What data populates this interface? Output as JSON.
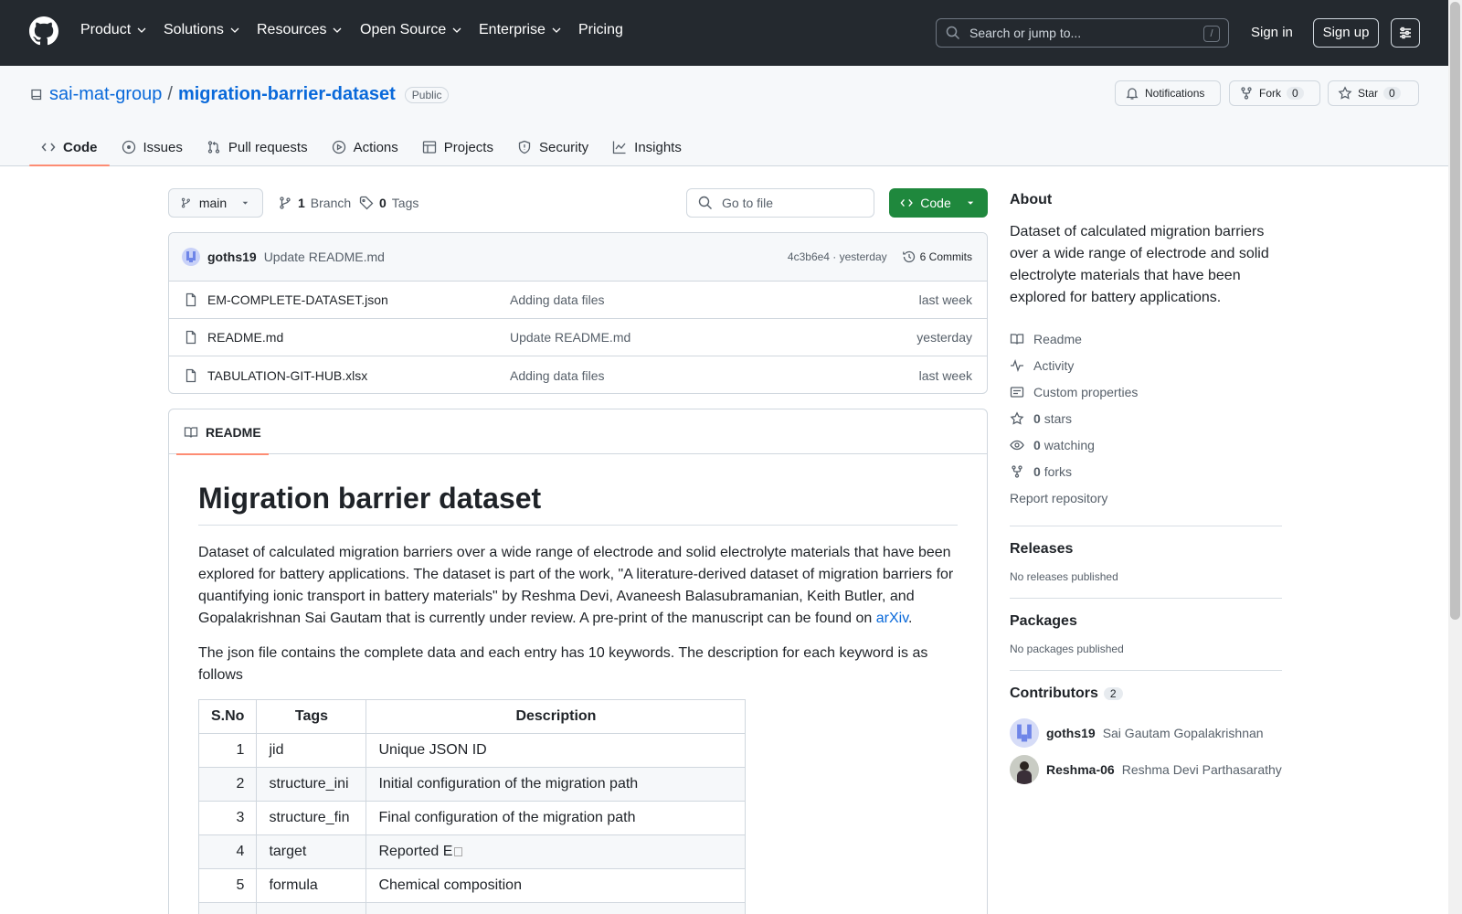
{
  "header": {
    "nav": [
      "Product",
      "Solutions",
      "Resources",
      "Open Source",
      "Enterprise",
      "Pricing"
    ],
    "search_placeholder": "Search or jump to...",
    "slash": "/",
    "sign_in": "Sign in",
    "sign_up": "Sign up"
  },
  "repo": {
    "owner": "sai-mat-group",
    "sep": "/",
    "name": "migration-barrier-dataset",
    "visibility": "Public",
    "notifications": "Notifications",
    "fork_label": "Fork",
    "fork_count": "0",
    "star_label": "Star",
    "star_count": "0"
  },
  "tabs": [
    "Code",
    "Issues",
    "Pull requests",
    "Actions",
    "Projects",
    "Security",
    "Insights"
  ],
  "toolbar": {
    "branch": "main",
    "branch_count": "1",
    "branch_label": "Branch",
    "tag_count": "0",
    "tag_label": "Tags",
    "goto_placeholder": "Go to file",
    "code_label": "Code"
  },
  "commit": {
    "user": "goths19",
    "message": "Update README.md",
    "hash": "4c3b6e4 · yesterday",
    "commits": "6 Commits"
  },
  "files": [
    {
      "name": "EM-COMPLETE-DATASET.json",
      "message": "Adding data files",
      "age": "last week"
    },
    {
      "name": "README.md",
      "message": "Update README.md",
      "age": "yesterday"
    },
    {
      "name": "TABULATION-GIT-HUB.xlsx",
      "message": "Adding data files",
      "age": "last week"
    }
  ],
  "readme": {
    "tab": "README",
    "title": "Migration barrier dataset",
    "p1_a": "Dataset of calculated migration barriers over a wide range of electrode and solid electrolyte materials that have been explored for battery applications. The dataset is part of the work, \"A literature-derived dataset of migration barriers for quantifying ionic transport in battery materials\" by Reshma Devi, Avaneesh Balasubramanian, Keith Butler, and Gopalakrishnan Sai Gautam that is currently under review. A pre-print of the manuscript can be found on ",
    "p1_link": "arXiv",
    "p1_end": ".",
    "p2": "The json file contains the complete data and each entry has 10 keywords. The description for each keyword is as follows",
    "table_headers": [
      "S.No",
      "Tags",
      "Description"
    ],
    "rows": [
      {
        "n": "1",
        "tag": "jid",
        "desc": "Unique JSON ID"
      },
      {
        "n": "2",
        "tag": "structure_ini",
        "desc": "Initial configuration of the migration path"
      },
      {
        "n": "3",
        "tag": "structure_fin",
        "desc": "Final configuration of the migration path"
      },
      {
        "n": "4",
        "tag": "target",
        "desc": "Reported E"
      },
      {
        "n": "5",
        "tag": "formula",
        "desc": "Chemical composition"
      },
      {
        "n": "",
        "tag": "",
        "desc": ""
      }
    ]
  },
  "about": {
    "heading": "About",
    "description": "Dataset of calculated migration barriers over a wide range of electrode and solid electrolyte materials that have been explored for battery applications.",
    "readme": "Readme",
    "activity": "Activity",
    "custom": "Custom properties",
    "stars_n": "0",
    "stars": "stars",
    "watching_n": "0",
    "watching": "watching",
    "forks_n": "0",
    "forks": "forks",
    "report": "Report repository"
  },
  "releases": {
    "heading": "Releases",
    "note": "No releases published"
  },
  "packages": {
    "heading": "Packages",
    "note": "No packages published"
  },
  "contributors": {
    "heading": "Contributors",
    "count": "2",
    "people": [
      {
        "login": "goths19",
        "name": "Sai Gautam Gopalakrishnan"
      },
      {
        "login": "Reshma-06",
        "name": "Reshma Devi Parthasarathy"
      }
    ]
  }
}
